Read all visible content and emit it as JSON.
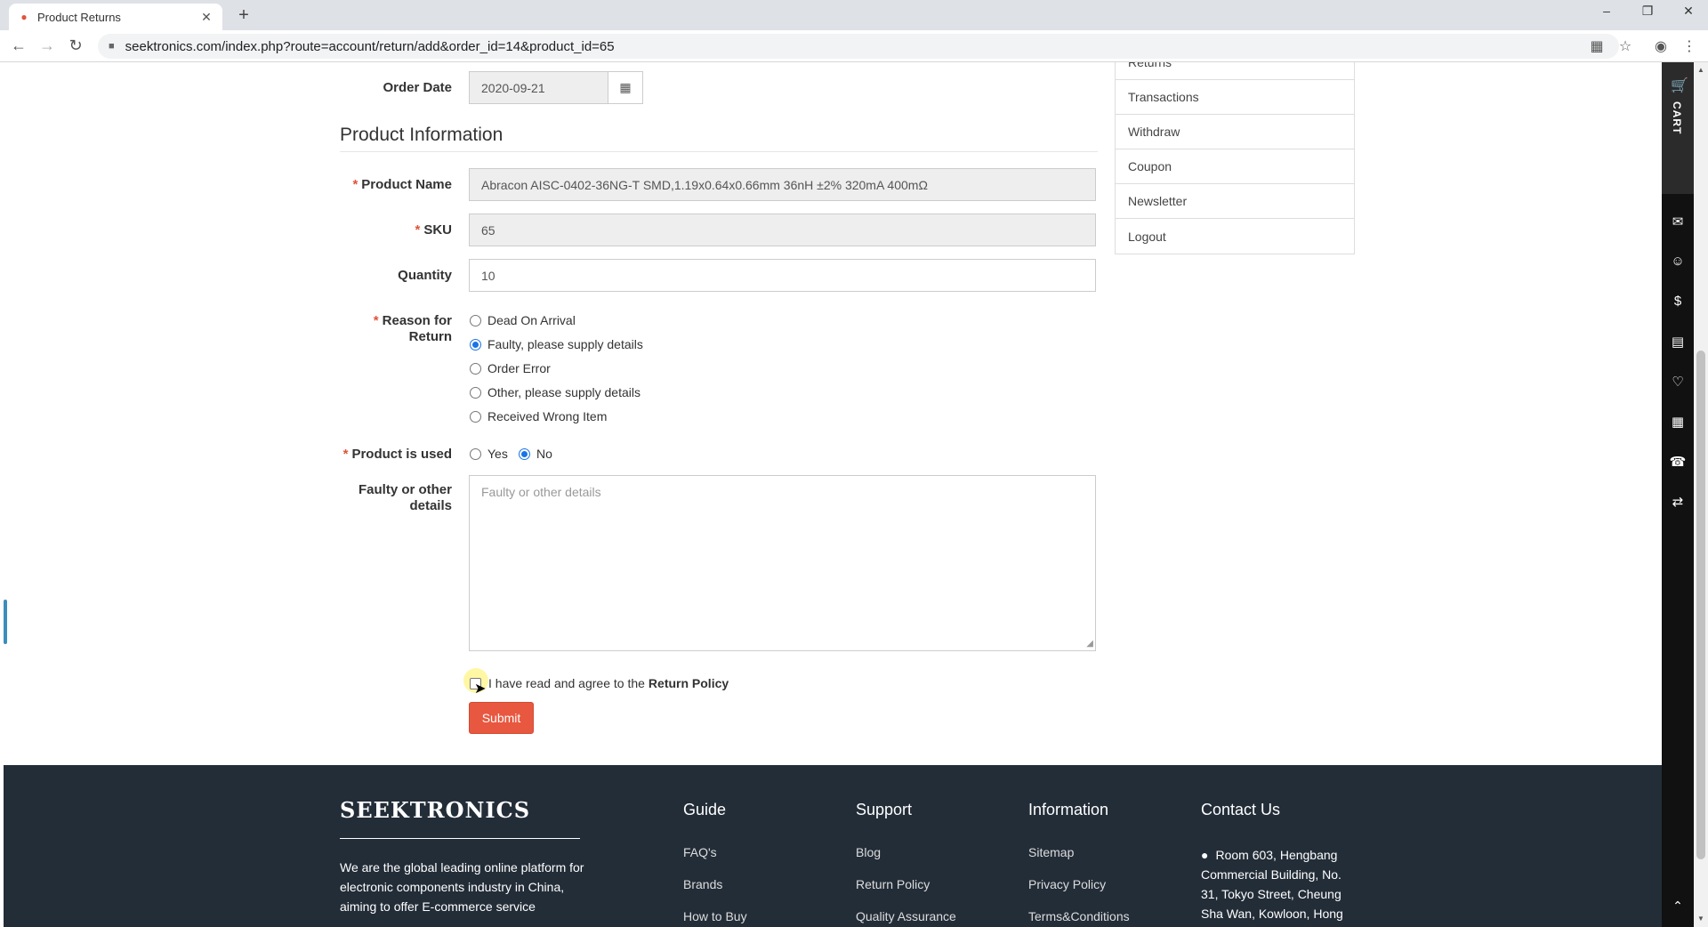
{
  "browser": {
    "tab_title": "Product Returns",
    "url": "seektronics.com/index.php?route=account/return/add&order_id=14&product_id=65"
  },
  "form": {
    "order_date_label": "Order Date",
    "order_date_value": "2020-09-21",
    "section_title": "Product Information",
    "product_name_label": "Product Name",
    "product_name_value": "Abracon AISC-0402-36NG-T SMD,1.19x0.64x0.66mm 36nH ±2% 320mA 400mΩ",
    "sku_label": "SKU",
    "sku_value": "65",
    "quantity_label": "Quantity",
    "quantity_value": "10",
    "reason_label_line1": "Reason for",
    "reason_label_line2": "Return",
    "reasons": [
      {
        "label": "Dead On Arrival",
        "selected": false
      },
      {
        "label": "Faulty, please supply details",
        "selected": true
      },
      {
        "label": "Order Error",
        "selected": false
      },
      {
        "label": "Other, please supply details",
        "selected": false
      },
      {
        "label": "Received Wrong Item",
        "selected": false
      }
    ],
    "used_label": "Product is used",
    "used_yes": "Yes",
    "used_no": "No",
    "used_value": "No",
    "details_label_line1": "Faulty or other",
    "details_label_line2": "details",
    "details_placeholder": "Faulty or other details",
    "agree_text": "I have read and agree to the",
    "agree_link": "Return Policy",
    "submit_label": "Submit"
  },
  "account_menu": [
    "Returns",
    "Transactions",
    "Withdraw",
    "Coupon",
    "Newsletter",
    "Logout"
  ],
  "footer": {
    "brand": "SEEKTRONICS",
    "about": "We are the global leading online platform for electronic components industry in China, aiming to offer E-commerce service",
    "columns": [
      {
        "title": "Guide",
        "links": [
          "FAQ's",
          "Brands",
          "How to Buy"
        ]
      },
      {
        "title": "Support",
        "links": [
          "Blog",
          "Return Policy",
          "Quality Assurance"
        ]
      },
      {
        "title": "Information",
        "links": [
          "Sitemap",
          "Privacy Policy",
          "Terms&Conditions"
        ]
      }
    ],
    "contact_title": "Contact Us",
    "contact_address": "Room 603, Hengbang Commercial Building, No. 31, Tokyo Street, Cheung Sha Wan, Kowloon, Hong"
  },
  "sidebar": {
    "cart_label": "CART",
    "icons": [
      "chat-icon",
      "user-icon",
      "dollar-icon",
      "document-icon",
      "heart-icon",
      "clipboard-icon",
      "phone-icon",
      "transfer-icon"
    ]
  },
  "colors": {
    "accent": "#e8573f",
    "footer_bg": "#232d38",
    "radio_selected": "#1a73e8"
  }
}
